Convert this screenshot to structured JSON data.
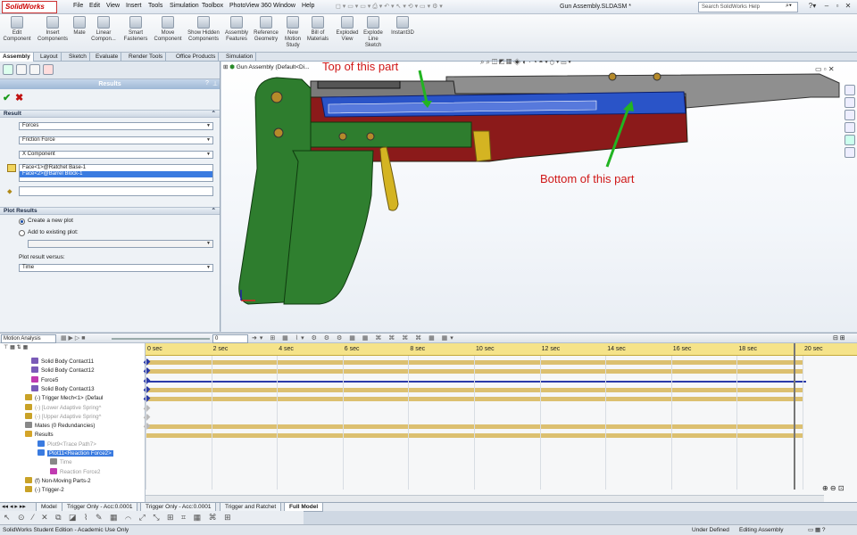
{
  "app": {
    "logo_text": "SolidWorks",
    "doc_title": "Gun Assembly.SLDASM *",
    "search_placeholder": "Search SolidWorks Help"
  },
  "menu": [
    "File",
    "Edit",
    "View",
    "Insert",
    "Tools",
    "Simulation",
    "Toolbox",
    "PhotoView 360",
    "Window",
    "Help"
  ],
  "ribbon": [
    "Edit Component",
    "Insert Components",
    "Mate",
    "Linear Compon...",
    "Smart Fasteners",
    "Move Component",
    "Show Hidden Components",
    "Assembly Features",
    "Reference Geometry",
    "New Motion Study",
    "Bill of Materials",
    "Exploded View",
    "Explode Line Sketch",
    "Instant3D"
  ],
  "cm_tabs": [
    "Assembly",
    "Layout",
    "Sketch",
    "Evaluate",
    "Render Tools",
    "Office Products",
    "Simulation"
  ],
  "property_manager": {
    "title": "Results",
    "section_result": "Result",
    "category": "Forces",
    "subcategory": "Friction Force",
    "component": "X Component",
    "faces": [
      "Face<1>@Ratchet Base-1",
      "Face<2>@Barrel Block-1"
    ],
    "section_plot": "Plot Results",
    "radio_new": "Create a new plot",
    "radio_existing": "Add to existing plot:",
    "plot_versus_label": "Plot result versus:",
    "plot_versus": "Time"
  },
  "graphics": {
    "tree_root": "Gun Assembly (Default<Di...",
    "annotation_top": "Top of this part",
    "annotation_bottom": "Bottom of this part",
    "arrow_color": "#22b422",
    "annotation_color": "#d01818",
    "part_colors": {
      "grip": "#2e7d2e",
      "body": "#8b1a1a",
      "barrel": "#888888",
      "slide": "#2a54c8",
      "trigger": "#d4b422"
    }
  },
  "motion": {
    "study_type": "Motion Analysis",
    "time_value": "0",
    "ticks": [
      "0 sec",
      "2 sec",
      "4 sec",
      "6 sec",
      "8 sec",
      "10 sec",
      "12 sec",
      "14 sec",
      "16 sec",
      "18 sec",
      "20 sec"
    ],
    "tree": [
      {
        "label": "Solid Body Contact11",
        "indent": 35,
        "icon": "contact-icon",
        "muted": false
      },
      {
        "label": "Solid Body Contact12",
        "indent": 35,
        "icon": "contact-icon",
        "muted": false
      },
      {
        "label": "Force5",
        "indent": 35,
        "icon": "force-icon",
        "muted": false
      },
      {
        "label": "Solid Body Contact13",
        "indent": 35,
        "icon": "contact-icon",
        "muted": false
      },
      {
        "label": "(-) Trigger Mech<1> (Defaul",
        "indent": 28,
        "icon": "part-icon",
        "muted": false
      },
      {
        "label": "(-) [Lower Adaptive Spring^",
        "indent": 28,
        "icon": "part-icon",
        "muted": true
      },
      {
        "label": "(-) [Upper Adaptive Spring^",
        "indent": 28,
        "icon": "part-icon",
        "muted": true
      },
      {
        "label": "Mates (0 Redundancies)",
        "indent": 28,
        "icon": "mates-icon",
        "muted": false
      },
      {
        "label": "Results",
        "indent": 28,
        "icon": "results-icon",
        "muted": false
      },
      {
        "label": "Plot9<Trace Path7>",
        "indent": 42,
        "icon": "plot-icon",
        "muted": true
      },
      {
        "label": "Plot11<Reaction Force2>",
        "indent": 42,
        "icon": "plot-icon",
        "muted": false,
        "selected": true
      },
      {
        "label": "Time",
        "indent": 56,
        "icon": "time-icon",
        "muted": true
      },
      {
        "label": "Reaction Force2",
        "indent": 56,
        "icon": "force-icon",
        "muted": true
      },
      {
        "label": "(f) Non-Moving Parts-2",
        "indent": 28,
        "icon": "part-icon",
        "muted": false
      },
      {
        "label": "(-) Trigger-2",
        "indent": 28,
        "icon": "part-icon",
        "muted": false
      }
    ]
  },
  "sheet_tabs": [
    "Model",
    "Trigger Only - Acc:0.0001",
    "Trigger Only - Acc:0.0001",
    "Trigger and Ratchet",
    "Full Model"
  ],
  "active_sheet": "Full Model",
  "status": {
    "edition": "SolidWorks Student Edition - Academic Use Only",
    "state": "Under Defined",
    "mode": "Editing Assembly"
  }
}
